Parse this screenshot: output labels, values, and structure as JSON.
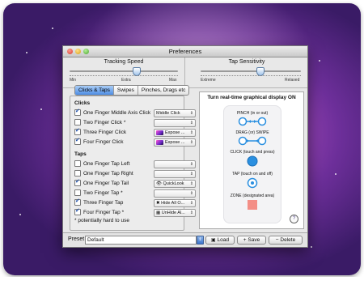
{
  "window": {
    "title": "Preferences"
  },
  "tracking": {
    "header": "Tracking Speed",
    "min": "Min",
    "extra": "Extra",
    "max": "Max",
    "level": 0.62
  },
  "tap": {
    "header": "Tap Sensitivity",
    "extreme": "Extreme",
    "relaxed": "Relaxed",
    "level": 0.6
  },
  "tabs": [
    {
      "label": "Clicks & Taps",
      "active": true
    },
    {
      "label": "Swipes",
      "active": false
    },
    {
      "label": "Pinches, Drags etc",
      "active": false
    }
  ],
  "clicks": {
    "section": "Clicks",
    "items": [
      {
        "label": "One Finger Middle Axis Click",
        "checked": true,
        "popup": "Middle Click"
      },
      {
        "label": "Two Finger Click *",
        "checked": false,
        "popup": ""
      },
      {
        "label": "Three Finger Click",
        "checked": true,
        "popup": "Expose ..."
      },
      {
        "label": "Four Finger Click",
        "checked": true,
        "popup": "Expose ..."
      }
    ]
  },
  "taps": {
    "section": "Taps",
    "items": [
      {
        "label": "One Finger Tap Left",
        "checked": false,
        "popup": ""
      },
      {
        "label": "One Finger Tap Right",
        "checked": false,
        "popup": ""
      },
      {
        "label": "One Finger Tap  Tail",
        "checked": true,
        "popup": "QuickLook"
      },
      {
        "label": "Two Finger Tap *",
        "checked": false,
        "popup": ""
      },
      {
        "label": "Three Finger Tap",
        "checked": true,
        "popup": "Hide All O..."
      },
      {
        "label": "Four Finger Tap *",
        "checked": true,
        "popup": "UnHide Al..."
      }
    ]
  },
  "note": "* potentially hard to use",
  "display": {
    "title": "Turn real-time graphical display ON",
    "legend": {
      "pinch": "PINCH (in or out)",
      "drag": "DRAG (or) SWIPE",
      "click": "CLICK (touch and press)",
      "tap": "TAP (touch on and off)",
      "zone": "ZONE (designated area)"
    },
    "help": "?",
    "colors": {
      "accent": "#2a8fe0",
      "zone": "#f38e86"
    }
  },
  "preset": {
    "label": "Preset",
    "value": "Default",
    "load": "Load",
    "save": "+ Save",
    "delete": "− Delete"
  }
}
